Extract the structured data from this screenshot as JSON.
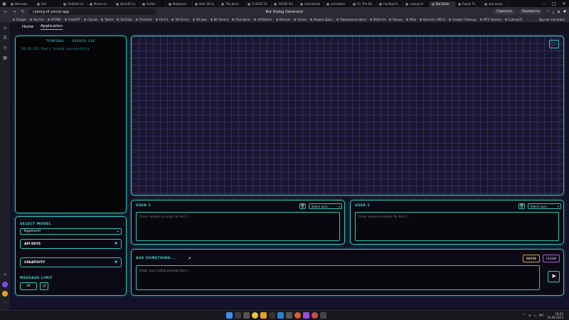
{
  "browser": {
    "tabs": [
      {
        "title": "Фильмы",
        "active": false
      },
      {
        "title": "Unt",
        "active": false
      },
      {
        "title": "Untitled (m",
        "active": false
      },
      {
        "title": "Moves.io",
        "active": false
      },
      {
        "title": "OpenAI Ca",
        "active": false
      },
      {
        "title": "Codex",
        "active": false
      },
      {
        "title": "Формула",
        "active": false
      },
      {
        "title": "Best 30 ex",
        "active": false
      },
      {
        "title": "The Journ",
        "active": false
      },
      {
        "title": "(1/2025.31",
        "active": false
      },
      {
        "title": "1915D SCI",
        "active": false
      },
      {
        "title": "iamcoltedu",
        "active": false
      },
      {
        "title": "iamcolted",
        "active": false
      },
      {
        "title": "(1) Tim Do",
        "active": false
      },
      {
        "title": "Configurin",
        "active": false
      },
      {
        "title": "cyborg-id",
        "active": false
      },
      {
        "title": "Bot Dialo",
        "active": true
      },
      {
        "title": "Papak TV",
        "active": false
      },
      {
        "title": "aka.ampo",
        "active": false
      }
    ],
    "url": "cyborg-id.vercel.app",
    "page_title": "Bot Dialog Generator",
    "nav_right": {
      "ask": "Спросить",
      "translate": "Перевести"
    },
    "bookmarks": [
      "Google",
      "Восток",
      "AFFINE",
      "ChatGPT",
      "Claude",
      "Twitch",
      "YouTube",
      "Translate",
      "Почта",
      "VK Почта",
      "ЗН мио",
      "Bit Torrent",
      "Портфель",
      "ArtStation",
      "Stencils",
      "Ozone",
      "Яндекс Диск",
      "Переводчик фото",
      "Мебл бл",
      "Вакшу",
      "Mike",
      "Контакт LMS Б",
      "Google Таблицы",
      "MTS Звонки",
      "Cyborg.ID"
    ],
    "bookmarks_more": "Другие закладки"
  },
  "app": {
    "nav": {
      "home": "Home",
      "application": "Application"
    },
    "console": {
      "title": "TERMINAL - SERVER.EXE",
      "line": "[16:25:25] Users loaded successfully"
    },
    "controls": {
      "select_model_label": "SELECT MODEL",
      "model_value": "TogetherAI",
      "api_keys_label": "API KEYS",
      "creativity_label": "CREATIVITY",
      "message_limit_label": "MESSAGE LIMIT",
      "message_limit_value": "20"
    },
    "users": [
      {
        "title": "USER 1",
        "select_placeholder": "Select user...",
        "prompt_placeholder": "Enter system prompt for Bot 1..."
      },
      {
        "title": "USER 2",
        "select_placeholder": "Select user...",
        "prompt_placeholder": "Enter system prompt for Bot 2..."
      }
    ],
    "ask": {
      "title": "ASK SOMETHING...",
      "pause": "PAUSE",
      "clear": "CLEAR",
      "placeholder": "Enter your initial prompt here..."
    }
  },
  "taskbar": {
    "lang": "РУС",
    "time": "16:25",
    "date": "10.08.2025"
  },
  "colors": {
    "accent": "#2ec9b8",
    "pause": "#e9b45a",
    "clear": "#c176e0"
  }
}
